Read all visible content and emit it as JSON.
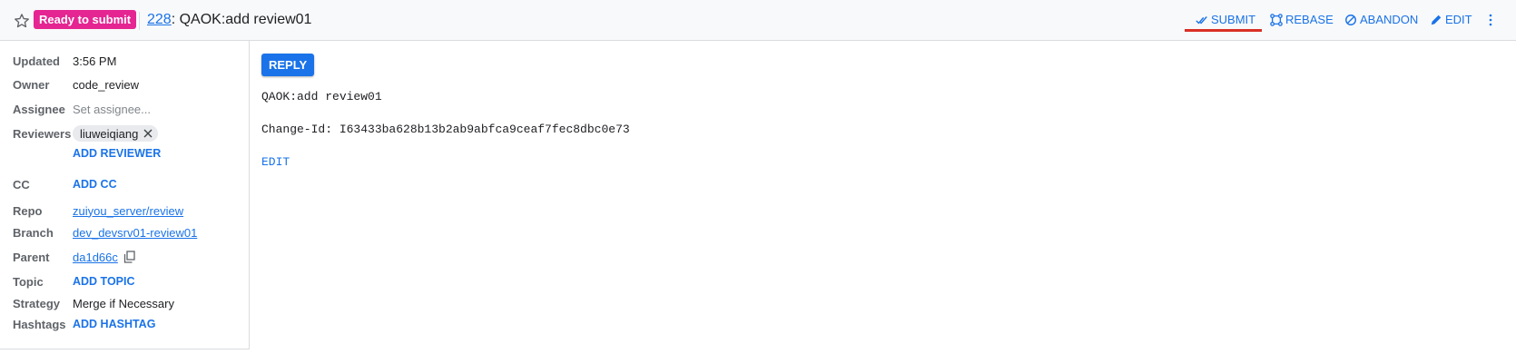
{
  "header": {
    "status_badge": "Ready to submit",
    "change_number": "228",
    "change_subject": ": QAOK:add review01",
    "actions": {
      "submit": "SUBMIT",
      "rebase": "REBASE",
      "abandon": "ABANDON",
      "edit": "EDIT"
    }
  },
  "sidebar": {
    "updated": {
      "label": "Updated",
      "value": "3:56 PM"
    },
    "owner": {
      "label": "Owner",
      "value": "code_review"
    },
    "assignee": {
      "label": "Assignee",
      "placeholder": "Set assignee..."
    },
    "reviewers": {
      "label": "Reviewers",
      "reviewer": "liuweiqiang",
      "add": "ADD REVIEWER"
    },
    "cc": {
      "label": "CC",
      "add": "ADD CC"
    },
    "repo": {
      "label": "Repo",
      "value": "zuiyou_server/review"
    },
    "branch": {
      "label": "Branch",
      "value": "dev_devsrv01-review01"
    },
    "parent": {
      "label": "Parent",
      "value": "da1d66c"
    },
    "topic": {
      "label": "Topic",
      "add": "ADD TOPIC"
    },
    "strategy": {
      "label": "Strategy",
      "value": "Merge if Necessary"
    },
    "hashtags": {
      "label": "Hashtags",
      "add": "ADD HASHTAG"
    }
  },
  "main": {
    "reply_label": "REPLY",
    "commit_message_line1": "QAOK:add review01",
    "change_id": "Change-Id: I63433ba628b13b2ab9abfca9ceaf7fec8dbc0e73",
    "edit_label": "EDIT"
  },
  "colors": {
    "accent": "#1a73e8",
    "badge": "#e52592",
    "submit_underline": "#d93025"
  },
  "icons": [
    "star-icon",
    "check-double-icon",
    "rebase-icon",
    "abandon-icon",
    "pencil-icon",
    "overflow-menu-icon",
    "close-icon",
    "copy-icon"
  ]
}
